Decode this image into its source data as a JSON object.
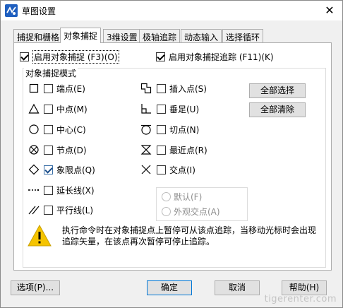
{
  "window": {
    "title": "草图设置",
    "close_symbol": "✕"
  },
  "tabs": [
    {
      "label": "捕捉和栅格"
    },
    {
      "label": "对象捕捉"
    },
    {
      "label": "3维设置"
    },
    {
      "label": "极轴追踪"
    },
    {
      "label": "动态输入"
    },
    {
      "label": "选择循环"
    }
  ],
  "active_tab": "对象捕捉",
  "top_options": {
    "enable_osnap": {
      "label": "启用对象捕捉 (F3)(O)",
      "checked": true
    },
    "enable_tracking": {
      "label": "启用对象捕捉追踪 (F11)(K)",
      "checked": true
    }
  },
  "group_title": "对象捕捉模式",
  "snap_modes_left": [
    {
      "icon": "square-marker-icon",
      "label": "端点(E)",
      "checked": false
    },
    {
      "icon": "triangle-marker-icon",
      "label": "中点(M)",
      "checked": false
    },
    {
      "icon": "circle-marker-icon",
      "label": "中心(C)",
      "checked": false
    },
    {
      "icon": "node-marker-icon",
      "label": "节点(D)",
      "checked": false
    },
    {
      "icon": "diamond-marker-icon",
      "label": "象限点(Q)",
      "checked": true
    },
    {
      "icon": "extension-marker-icon",
      "label": "延长线(X)",
      "checked": false
    },
    {
      "icon": "parallel-marker-icon",
      "label": "平行线(L)",
      "checked": false
    }
  ],
  "snap_modes_right": [
    {
      "icon": "insertion-marker-icon",
      "label": "插入点(S)",
      "checked": false
    },
    {
      "icon": "perpendicular-marker-icon",
      "label": "垂足(U)",
      "checked": false
    },
    {
      "icon": "tangent-marker-icon",
      "label": "切点(N)",
      "checked": false
    },
    {
      "icon": "nearest-marker-icon",
      "label": "最近点(R)",
      "checked": false
    },
    {
      "icon": "intersection-marker-icon",
      "label": "交点(I)",
      "checked": false
    }
  ],
  "select_buttons": {
    "select_all": "全部选择",
    "clear_all": "全部清除"
  },
  "radio_options": [
    {
      "label": "默认(F)",
      "selected": false,
      "disabled": true
    },
    {
      "label": "外观交点(A)",
      "selected": false,
      "disabled": true
    }
  ],
  "info_text": "执行命令时在对象捕捉点上暂停可从该点追踪，当移动光标时会出现追踪矢量，在该点再次暂停可停止追踪。",
  "footer": {
    "options": "选项(P)...",
    "ok": "确定",
    "cancel": "取消",
    "help": "帮助(H)"
  },
  "watermark": "tigerenter.com"
}
